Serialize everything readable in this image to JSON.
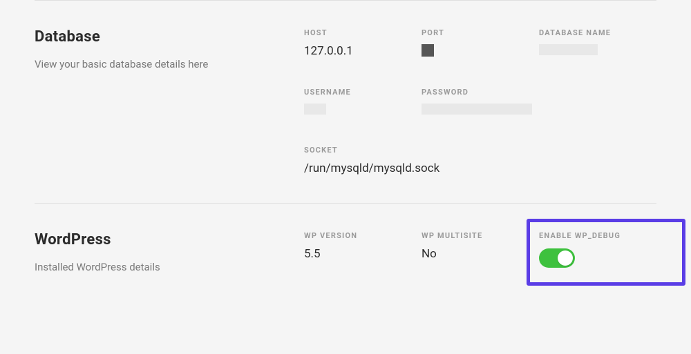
{
  "database": {
    "title": "Database",
    "subtitle": "View your basic database details here",
    "fields": {
      "host": {
        "label": "HOST",
        "value": "127.0.0.1"
      },
      "port": {
        "label": "PORT"
      },
      "database_name": {
        "label": "DATABASE NAME"
      },
      "username": {
        "label": "USERNAME"
      },
      "password": {
        "label": "PASSWORD"
      },
      "socket": {
        "label": "SOCKET",
        "value": "/run/mysqld/mysqld.sock"
      }
    }
  },
  "wordpress": {
    "title": "WordPress",
    "subtitle": "Installed WordPress details",
    "fields": {
      "wp_version": {
        "label": "WP VERSION",
        "value": "5.5"
      },
      "wp_multisite": {
        "label": "WP MULTISITE",
        "value": "No"
      },
      "enable_wp_debug": {
        "label": "ENABLE WP_DEBUG",
        "enabled": true
      }
    }
  }
}
